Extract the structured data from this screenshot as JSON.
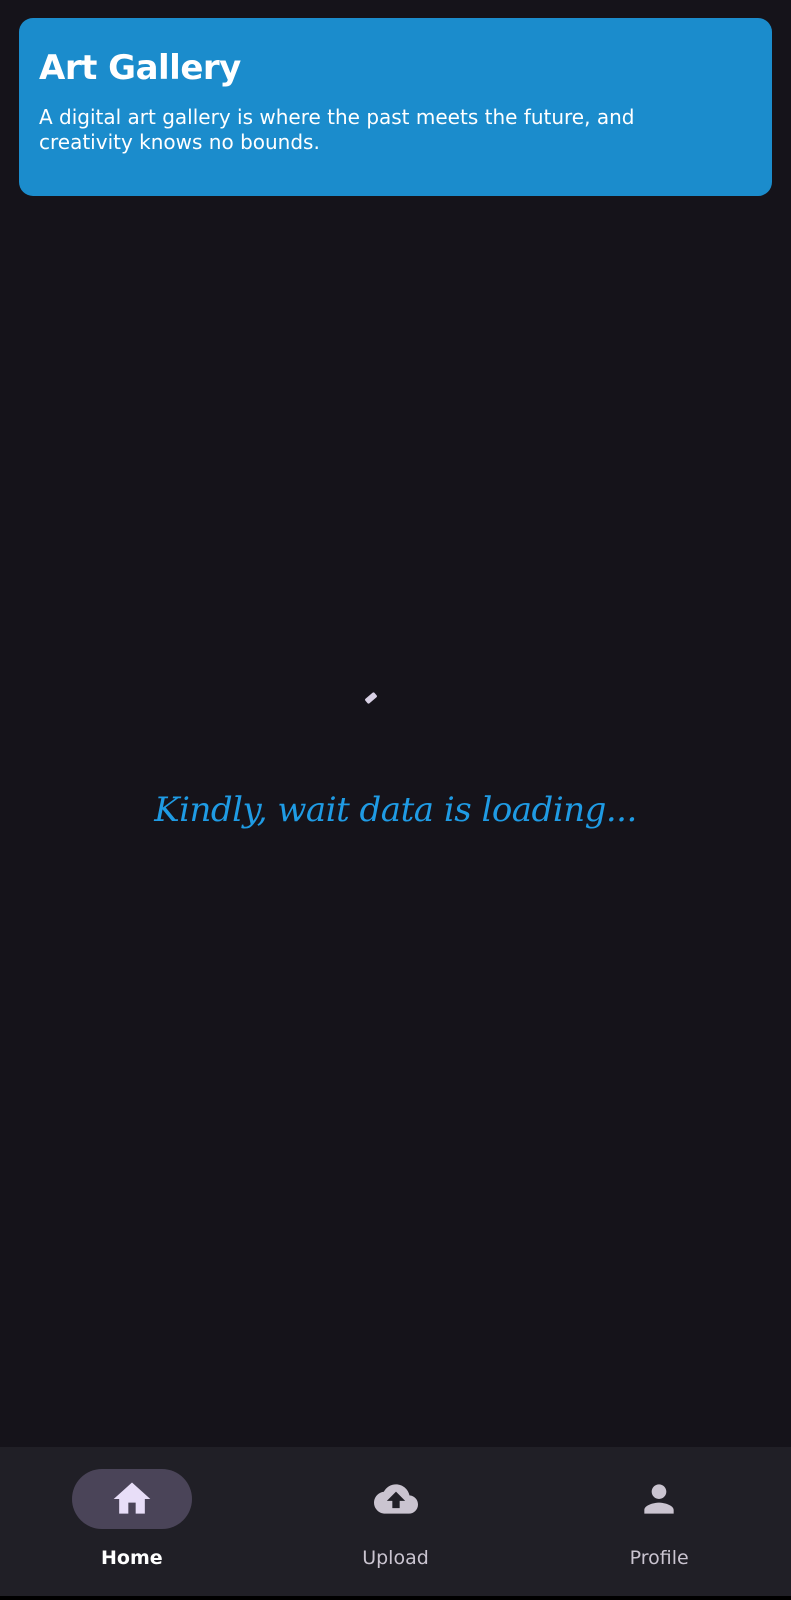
{
  "header": {
    "title": "Art Gallery",
    "description": "A digital art gallery is where the past meets the future, and creativity knows no bounds."
  },
  "loading": {
    "message": "Kindly, wait data is loading..."
  },
  "nav": {
    "items": [
      {
        "label": "Home",
        "icon": "home-icon",
        "active": true
      },
      {
        "label": "Upload",
        "icon": "cloud-upload-icon",
        "active": false
      },
      {
        "label": "Profile",
        "icon": "person-icon",
        "active": false
      }
    ]
  },
  "colors": {
    "background": "#15131a",
    "header": "#1b8ccc",
    "loading_text": "#1f9be4",
    "nav_background": "#201f26",
    "nav_active_pill": "#4a4458",
    "nav_icon": "#e8def8"
  }
}
